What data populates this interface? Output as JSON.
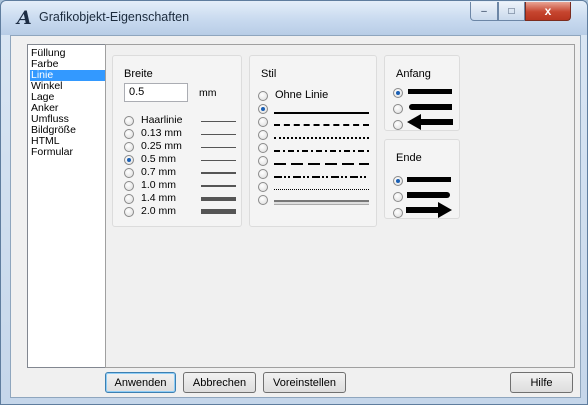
{
  "window": {
    "title": "Grafikobjekt-Eigenschaften",
    "controls": {
      "minimize": "–",
      "maximize": "□",
      "close": "x"
    }
  },
  "nav": {
    "items": [
      "Füllung",
      "Farbe",
      "Linie",
      "Winkel",
      "Lage",
      "Anker",
      "Umfluss",
      "Bildgröße",
      "HTML",
      "Formular"
    ],
    "selected_index": 2
  },
  "breite": {
    "title": "Breite",
    "value": "0.5",
    "unit": "mm",
    "options": [
      "Haarlinie",
      "0.13 mm",
      "0.25 mm",
      "0.5 mm",
      "0.7 mm",
      "1.0 mm",
      "1.4 mm",
      "2.0 mm"
    ],
    "selected_index": 3
  },
  "stil": {
    "title": "Stil",
    "none_label": "Ohne Linie",
    "options": [
      "solid",
      "dashed",
      "dotted",
      "dash-dot",
      "long-dash",
      "dash-dot-dot",
      "fine-dotted",
      "double"
    ],
    "selected_index": 1
  },
  "anfang": {
    "title": "Anfang",
    "options": [
      "plain",
      "rounded",
      "arrow"
    ],
    "selected_index": 0
  },
  "ende": {
    "title": "Ende",
    "options": [
      "plain",
      "rounded",
      "arrow"
    ],
    "selected_index": 0
  },
  "buttons": {
    "apply": "Anwenden",
    "cancel": "Abbrechen",
    "preset": "Voreinstellen",
    "help": "Hilfe"
  }
}
